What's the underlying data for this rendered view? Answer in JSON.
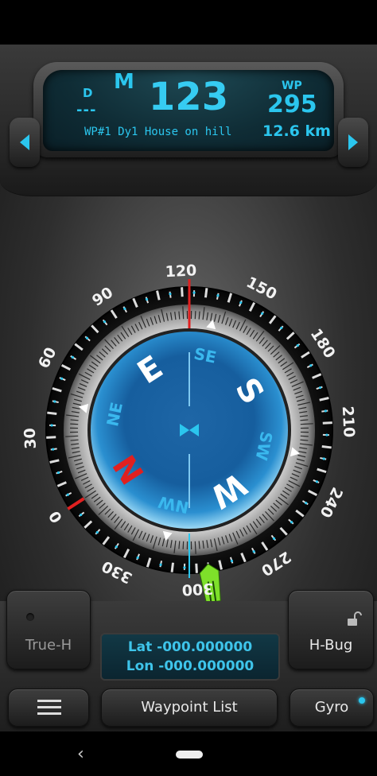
{
  "header": {
    "d_label": "D",
    "d_value": "---",
    "mode": "M",
    "heading": "123",
    "wp_label": "WP",
    "wp_bearing": "295",
    "waypoint_name": "WP#1 Dy1 House on hill",
    "distance": "12.6 km"
  },
  "compass": {
    "outer_labels": [
      "0",
      "30",
      "60",
      "90",
      "120",
      "150",
      "180",
      "210",
      "240",
      "270",
      "300",
      "330"
    ],
    "rose_labels": [
      "N",
      "NE",
      "E",
      "SE",
      "S",
      "SW",
      "W",
      "NW"
    ],
    "accent": "#2bc6ee",
    "north_color": "#e02020",
    "bug_color": "#7ee02a"
  },
  "buttons": {
    "true_h": "True-H",
    "h_bug": "H-Bug",
    "waypoint_list": "Waypoint List",
    "gyro": "Gyro"
  },
  "coords": {
    "lat": "Lat  -000.000000",
    "lon": "Lon  -000.000000"
  },
  "icons": {
    "prev": "chevron-left-icon",
    "next": "chevron-right-icon",
    "menu": "hamburger-menu-icon",
    "lock": "unlock-icon"
  }
}
